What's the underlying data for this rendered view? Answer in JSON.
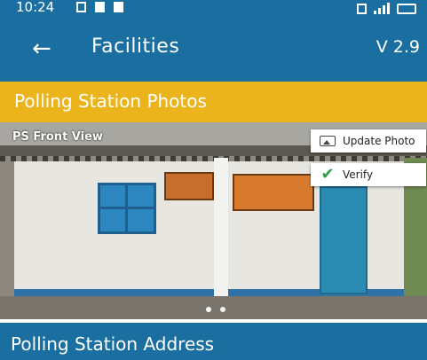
{
  "status_bar": {
    "time": "10:24",
    "icons": [
      "notification-icon",
      "image-icon",
      "message-icon"
    ],
    "right_icons": [
      "vibrate-icon",
      "signal-icon",
      "battery-icon"
    ]
  },
  "app_bar": {
    "back_icon": "←",
    "title": "Facilities",
    "version": "V 2.9"
  },
  "section_photos": {
    "title": "Polling Station Photos"
  },
  "photo": {
    "caption": "PS Front View",
    "update_label": "Update Photo",
    "verify_label": "Verify",
    "check_glyph": "✔"
  },
  "section_address": {
    "title": "Polling Station Address"
  },
  "colors": {
    "primary": "#1b6fa0",
    "accent": "#ecb41c",
    "verify": "#2ea043"
  }
}
